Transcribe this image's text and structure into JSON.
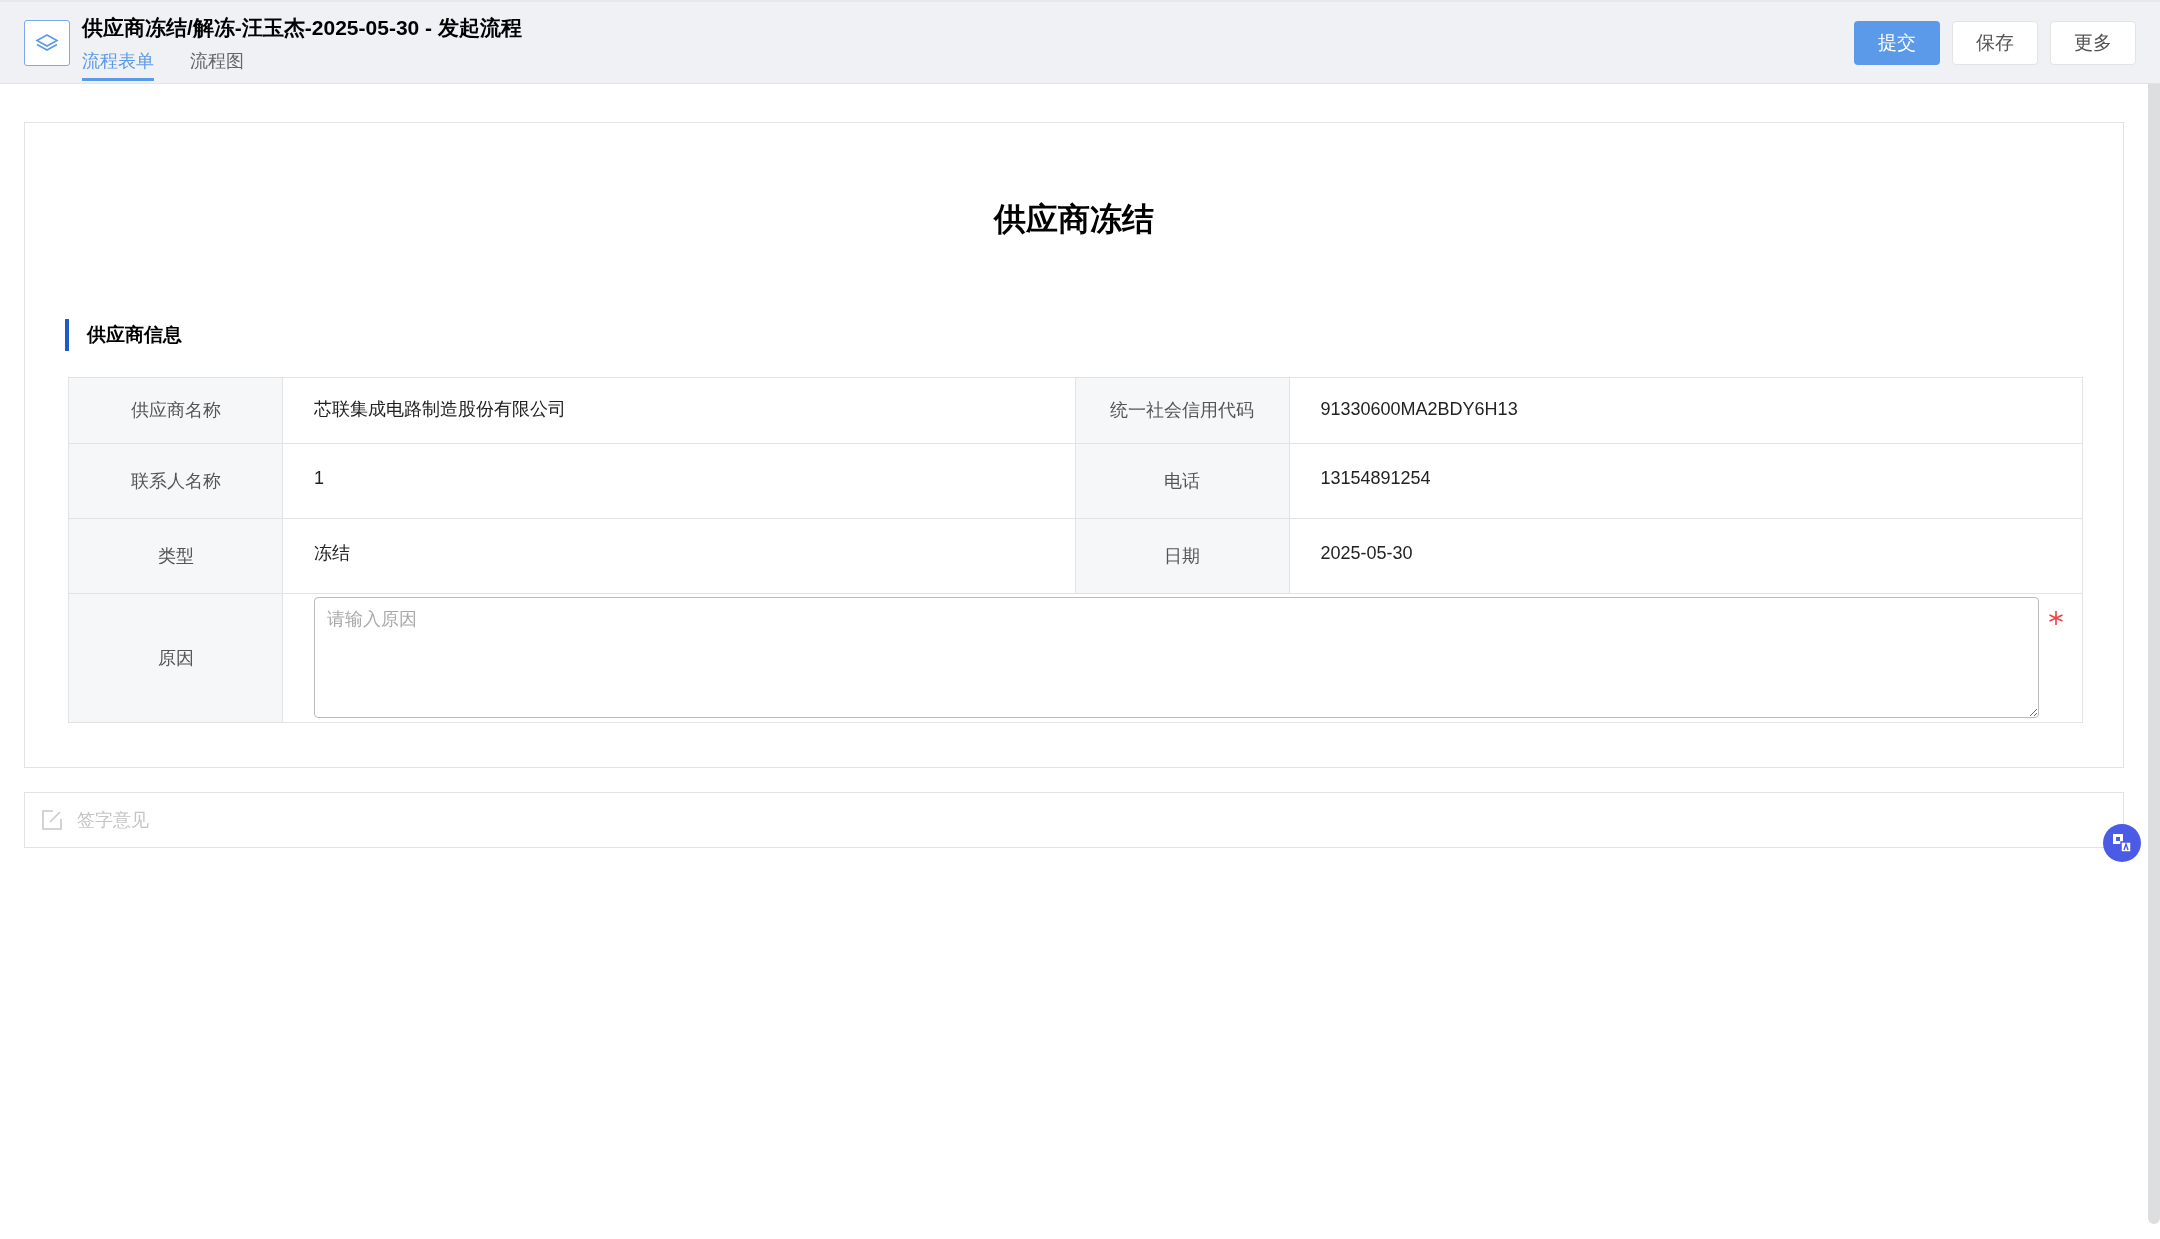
{
  "header": {
    "title": "供应商冻结/解冻-汪玉杰-2025-05-30 - 发起流程",
    "tabs": [
      {
        "label": "流程表单",
        "selected": true
      },
      {
        "label": "流程图",
        "selected": false
      }
    ],
    "buttons": [
      {
        "label": "提交",
        "kind": "primary"
      },
      {
        "label": "保存",
        "kind": "default"
      },
      {
        "label": "更多",
        "kind": "default"
      }
    ]
  },
  "form": {
    "title": "供应商冻结",
    "section": "供应商信息",
    "rows": [
      [
        {
          "label": "供应商名称",
          "value": "芯联集成电路制造股份有限公司"
        },
        {
          "label": "统一社会信用代码",
          "value": "91330600MA2BDY6H13"
        }
      ],
      [
        {
          "label": "联系人名称",
          "value": "1"
        },
        {
          "label": "电话",
          "value": "13154891254"
        }
      ],
      [
        {
          "label": "类型",
          "value": "冻结"
        },
        {
          "label": "日期",
          "value": "2025-05-30"
        }
      ]
    ],
    "reason": {
      "label": "原因",
      "placeholder": "请输入原因",
      "required": true
    }
  },
  "signature": {
    "placeholder": "签字意见"
  }
}
